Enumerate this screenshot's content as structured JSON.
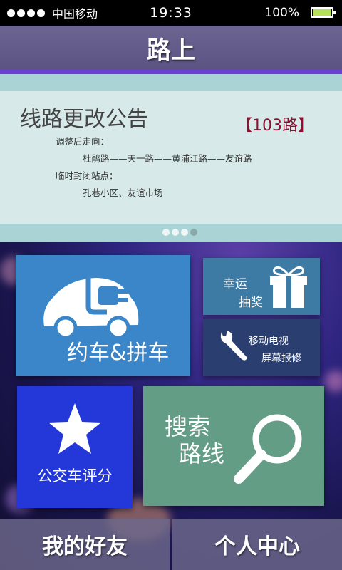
{
  "status_bar": {
    "carrier": "中国移动",
    "time": "19:33",
    "battery": "100%",
    "battery_level": 1.0,
    "signal_dots": 4
  },
  "header": {
    "title": "路上"
  },
  "banner": {
    "title": "线路更改公告",
    "route": "【103路】",
    "adjusted_label": "调整后走向：",
    "adjusted_route": "杜鹃路——天一路——黄浦江路——友谊路",
    "closed_label": "临时封闭站点：",
    "closed_stops": "孔巷小区、友谊市场",
    "page_count": 4,
    "active_page": 4
  },
  "tiles": {
    "carpool": {
      "label": "约车&拼车",
      "icon": "car-plug-icon"
    },
    "lottery": {
      "line1": "幸运",
      "line2": "抽奖",
      "icon": "gift-icon"
    },
    "repair": {
      "line1": "移动电视",
      "line2": "屏幕报修",
      "icon": "wrench-icon"
    },
    "rating": {
      "label": "公交车评分",
      "icon": "star-icon"
    },
    "search": {
      "line1": "搜索",
      "line2": "路线",
      "icon": "magnifier-icon"
    }
  },
  "bottom_nav": {
    "friends": "我的好友",
    "profile": "个人中心"
  },
  "colors": {
    "carpool": "#3b86c8",
    "lottery": "#3d7aa4",
    "repair": "#2a3f70",
    "rating": "#2438d9",
    "search": "#649d85",
    "route_badge": "#8c1030"
  }
}
